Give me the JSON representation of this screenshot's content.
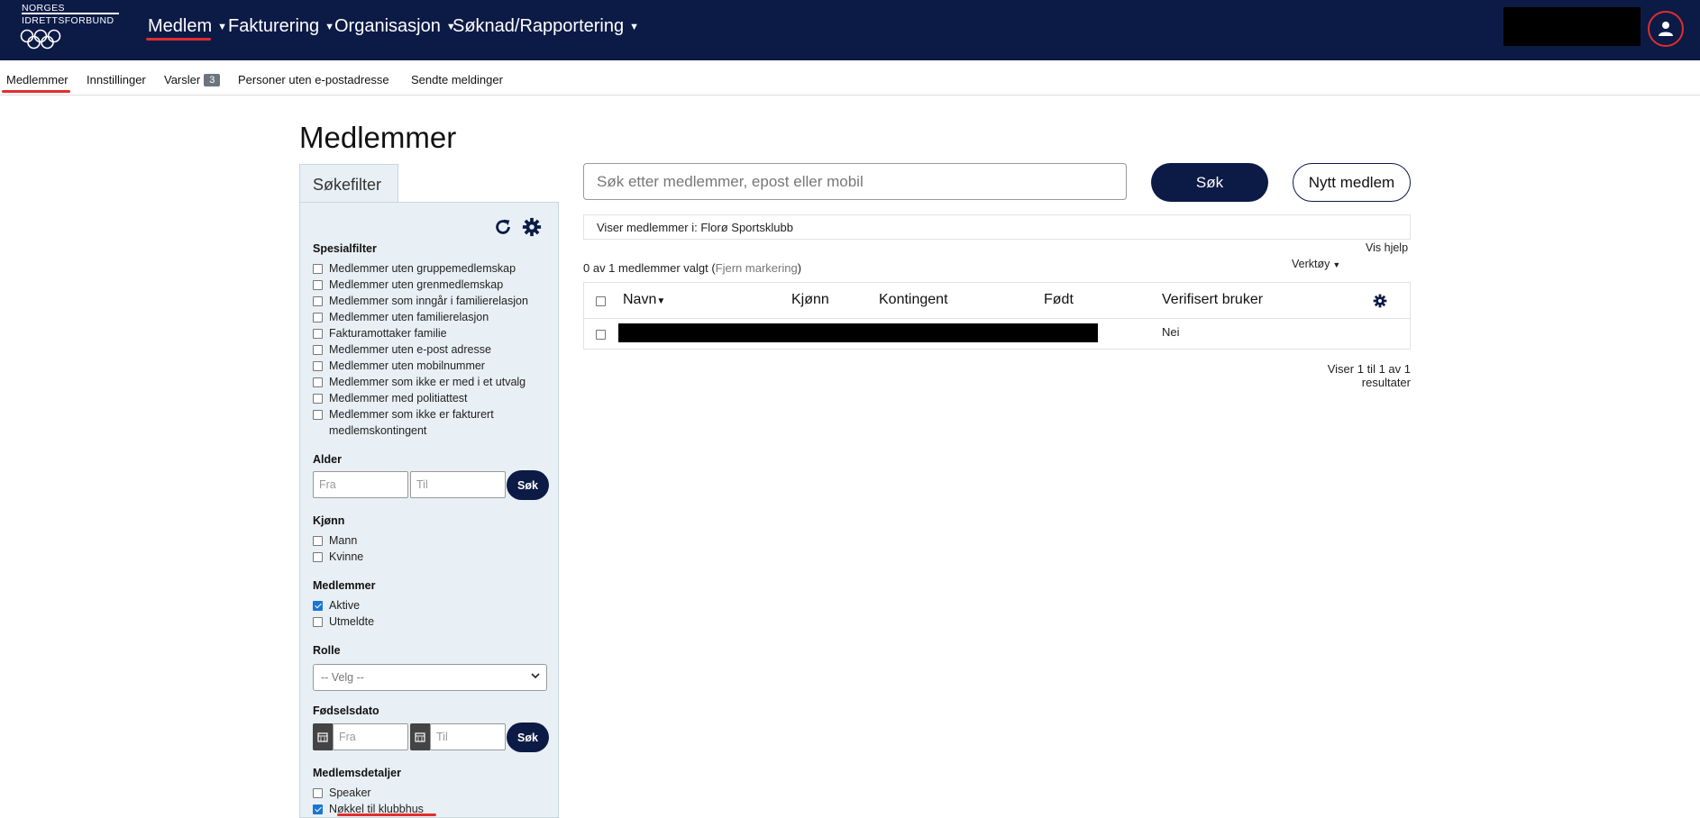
{
  "logo": {
    "line1": "NORGES",
    "line2": "IDRETTSFORBUND"
  },
  "topnav": [
    {
      "label": "Medlem"
    },
    {
      "label": "Fakturering"
    },
    {
      "label": "Organisasjon"
    },
    {
      "label": "Søknad/Rapportering"
    }
  ],
  "subnav": {
    "medlemmer": "Medlemmer",
    "innstillinger": "Innstillinger",
    "varsler": "Varsler",
    "varsler_count": "3",
    "personer": "Personer uten e-postadresse",
    "sendte": "Sendte meldinger"
  },
  "page_title": "Medlemmer",
  "filter": {
    "tab_label": "Søkefilter",
    "spesialfilter_label": "Spesialfilter",
    "spesialfilter": [
      {
        "label": "Medlemmer uten gruppemedlemskap",
        "checked": false
      },
      {
        "label": "Medlemmer uten grenmedlemskap",
        "checked": false
      },
      {
        "label": "Medlemmer som inngår i familierelasjon",
        "checked": false
      },
      {
        "label": "Medlemmer uten familierelasjon",
        "checked": false
      },
      {
        "label": "Fakturamottaker familie",
        "checked": false
      },
      {
        "label": "Medlemmer uten e-post adresse",
        "checked": false
      },
      {
        "label": "Medlemmer uten mobilnummer",
        "checked": false
      },
      {
        "label": "Medlemmer som ikke er med i et utvalg",
        "checked": false
      },
      {
        "label": "Medlemmer med politiattest",
        "checked": false
      },
      {
        "label": "Medlemmer som ikke er fakturert medlemskontingent",
        "checked": false
      }
    ],
    "alder_label": "Alder",
    "alder_fra_placeholder": "Fra",
    "alder_til_placeholder": "Til",
    "sok_label": "Søk",
    "kjonn_label": "Kjønn",
    "kjonn": [
      {
        "label": "Mann",
        "checked": false
      },
      {
        "label": "Kvinne",
        "checked": false
      }
    ],
    "medlemmer_label": "Medlemmer",
    "medlemmer": [
      {
        "label": "Aktive",
        "checked": true
      },
      {
        "label": "Utmeldte",
        "checked": false
      }
    ],
    "rolle_label": "Rolle",
    "rolle_selected": "-- Velg --",
    "fodselsdato_label": "Fødselsdato",
    "fodselsdato_fra_placeholder": "Fra",
    "fodselsdato_til_placeholder": "Til",
    "medlemsdetaljer_label": "Medlemsdetaljer",
    "medlemsdetaljer": [
      {
        "label": "Speaker",
        "checked": false
      },
      {
        "label": "Nøkkel til klubbhus",
        "checked": true
      }
    ]
  },
  "search": {
    "placeholder": "Søk etter medlemmer, epost eller mobil",
    "button": "Søk",
    "new_member": "Nytt medlem"
  },
  "viser_text": "Viser medlemmer i: Florø Sportsklubb",
  "vis_hjelp": "Vis hjelp",
  "verktoy": "Verktøy",
  "valgt": {
    "prefix": "0 av 1 medlemmer valgt (",
    "fjern": "Fjern markering",
    "suffix": ")"
  },
  "table": {
    "columns": [
      "Navn",
      "Kjønn",
      "Kontingent",
      "Født",
      "Verifisert bruker"
    ],
    "rows": [
      {
        "verifisert": "Nei"
      }
    ]
  },
  "results_text": "Viser 1 til 1 av 1 resultater",
  "colors": {
    "navy": "#0c1a46",
    "accent_red": "#e02e2e",
    "filter_bg": "#e8f0f5"
  }
}
